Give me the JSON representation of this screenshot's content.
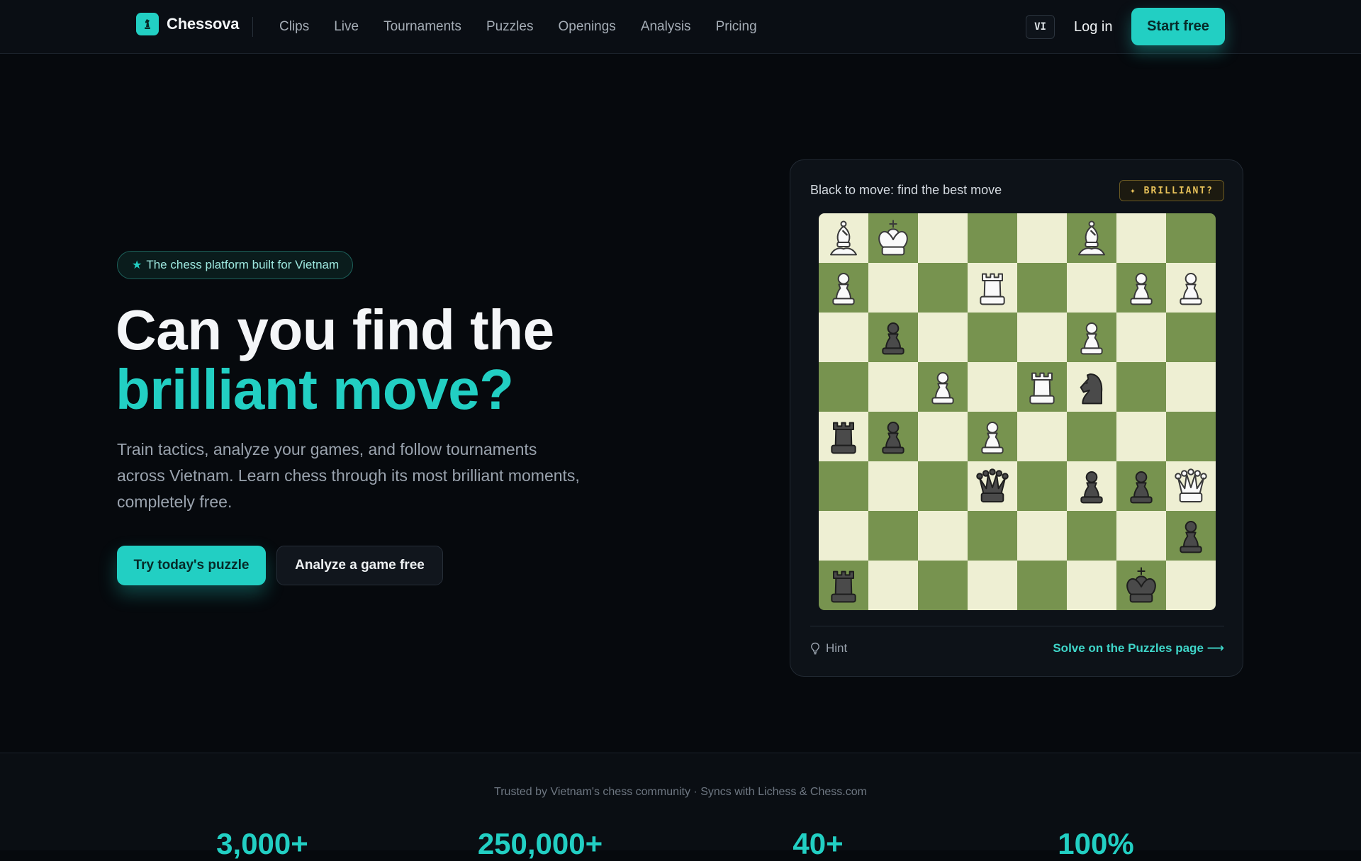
{
  "colors": {
    "accent": "#22cfc3",
    "board_light": "#eeefd3",
    "board_dark": "#77934f",
    "brilliant_gold": "#e8c25a"
  },
  "nav": {
    "brand": "Chessova",
    "links": [
      "Clips",
      "Live",
      "Tournaments",
      "Puzzles",
      "Openings",
      "Analysis",
      "Pricing"
    ],
    "language": "VI",
    "login": "Log in",
    "cta": "Start free"
  },
  "hero": {
    "badge": "The chess platform built for Vietnam",
    "headline_line1": "Can you find the",
    "headline_line2": "brilliant move?",
    "subtext": "Train tactics, analyze your games, and follow tournaments across Vietnam. Learn chess through its most brilliant moments, completely free.",
    "primary_button": "Try today's puzzle",
    "secondary_button": "Analyze a game free"
  },
  "puzzle": {
    "prompt": "Black to move: find the best move",
    "tag": "✦ BRILLIANT?",
    "board": [
      [
        "wB",
        "wK",
        "",
        "",
        "",
        "wB",
        "",
        ""
      ],
      [
        "wP",
        "",
        "",
        "wR",
        "",
        "",
        "wP",
        "wP"
      ],
      [
        "",
        "bP",
        "",
        "",
        "",
        "wP",
        "",
        ""
      ],
      [
        "",
        "",
        "wP",
        "",
        "wR",
        "bN",
        "",
        ""
      ],
      [
        "bR",
        "bP",
        "",
        "wP",
        "",
        "",
        "",
        ""
      ],
      [
        "",
        "",
        "",
        "bQ",
        "",
        "bP",
        "bP",
        "wQ"
      ],
      [
        "",
        "",
        "",
        "",
        "",
        "",
        "",
        "bP"
      ],
      [
        "bR",
        "",
        "",
        "",
        "",
        "",
        "bK",
        ""
      ]
    ],
    "hint_label": "Hint",
    "solve_link": "Solve on the Puzzles page ⟶"
  },
  "trust": {
    "line": "Trusted by Vietnam's chess community · Syncs with Lichess & Chess.com",
    "stats": [
      "3,000+",
      "250,000+",
      "40+",
      "100%"
    ]
  }
}
